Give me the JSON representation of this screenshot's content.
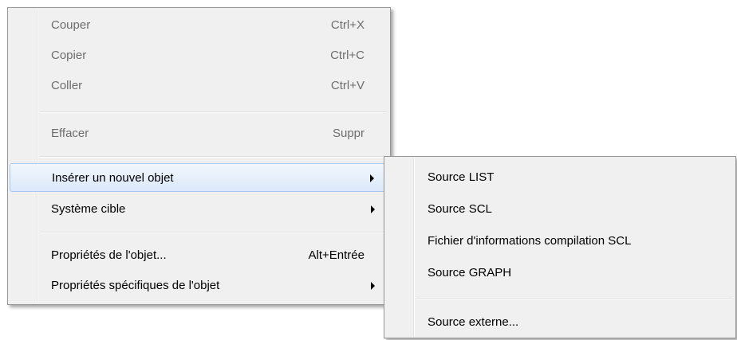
{
  "main_menu": {
    "items": [
      {
        "label": "Couper",
        "shortcut": "Ctrl+X"
      },
      {
        "label": "Copier",
        "shortcut": "Ctrl+C"
      },
      {
        "label": "Coller",
        "shortcut": "Ctrl+V"
      },
      {
        "label": "Effacer",
        "shortcut": "Suppr"
      },
      {
        "label": "Insérer un nouvel objet"
      },
      {
        "label": "Système cible"
      },
      {
        "label": "Propriétés de l'objet...",
        "shortcut": "Alt+Entrée"
      },
      {
        "label": "Propriétés spécifiques de l'objet"
      }
    ]
  },
  "sub_menu": {
    "items": [
      {
        "label": "Source LIST"
      },
      {
        "label": "Source SCL"
      },
      {
        "label": "Fichier d'informations compilation SCL"
      },
      {
        "label": "Source GRAPH"
      },
      {
        "label": "Source externe..."
      }
    ]
  },
  "colors": {
    "menu_bg": "#f0f0f0",
    "disabled_text": "#6d6d6d",
    "highlight_border": "#a8c8ee"
  }
}
